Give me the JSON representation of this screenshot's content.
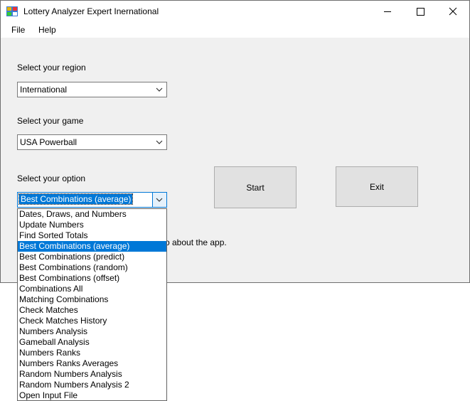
{
  "window": {
    "title": "Lottery Analyzer Expert Inernational"
  },
  "menu": {
    "file": "File",
    "help": "Help"
  },
  "region": {
    "label": "Select your region",
    "value": "International"
  },
  "game": {
    "label": "Select your game",
    "value": "USA Powerball"
  },
  "option": {
    "label": "Select your option",
    "value": "Best Combinations (average)",
    "items": [
      "Dates, Draws, and Numbers",
      "Update Numbers",
      "Find Sorted Totals",
      "Best Combinations (average)",
      "Best Combinations (predict)",
      "Best Combinations (random)",
      "Best Combinations (offset)",
      "Combinations All",
      "Matching Combinations",
      "Check Matches",
      "Check Matches History",
      "Numbers Analysis",
      "Gameball Analysis",
      "Numbers Ranks",
      "Numbers Ranks Averages",
      "Random Numbers Analysis",
      "Random Numbers Analysis 2",
      "Open Input File"
    ],
    "selected_index": 3
  },
  "buttons": {
    "start": "Start",
    "exit": "Exit"
  },
  "info_text": "o about the app.",
  "colors": {
    "accent": "#0078d7",
    "background": "#f0f0f0"
  },
  "icons": {
    "app": "app-icon",
    "minimize": "minimize-icon",
    "maximize": "maximize-icon",
    "close": "close-icon",
    "dropdown": "chevron-down-icon"
  }
}
